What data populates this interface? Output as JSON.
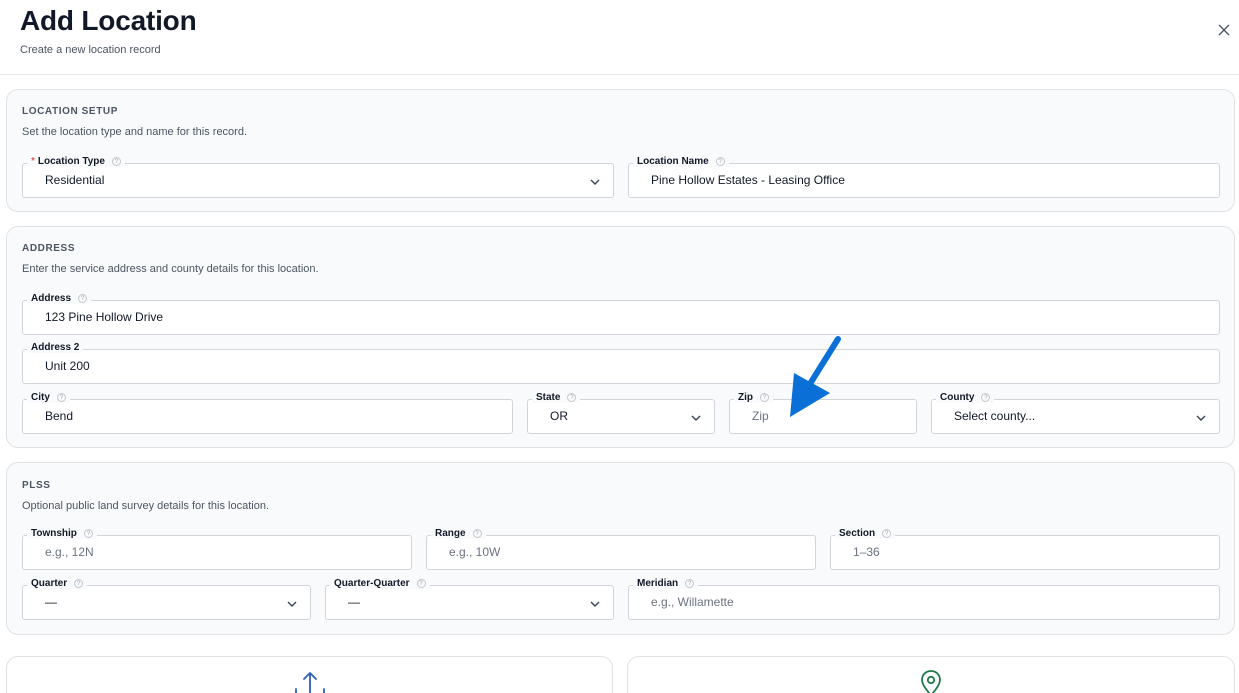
{
  "header": {
    "title": "Add Location",
    "subtitle": "Create a new location record"
  },
  "location_setup": {
    "title": "LOCATION SETUP",
    "description": "Set the location type and name for this record.",
    "location_type": {
      "label": "Location Type",
      "required": "*",
      "value": "Residential"
    },
    "location_name": {
      "label": "Location Name",
      "value": "Pine Hollow Estates - Leasing Office"
    }
  },
  "address": {
    "title": "ADDRESS",
    "description": "Enter the service address and county details for this location.",
    "address1": {
      "label": "Address",
      "value": "123 Pine Hollow Drive"
    },
    "address2": {
      "label": "Address 2",
      "value": "Unit 200"
    },
    "city": {
      "label": "City",
      "value": "Bend"
    },
    "state": {
      "label": "State",
      "value": "OR"
    },
    "zip": {
      "label": "Zip",
      "placeholder": "Zip"
    },
    "county": {
      "label": "County",
      "placeholder": "Select county..."
    }
  },
  "plss": {
    "title": "PLSS",
    "description": "Optional public land survey details for this location.",
    "township": {
      "label": "Township",
      "placeholder": "e.g., 12N"
    },
    "range": {
      "label": "Range",
      "placeholder": "e.g., 10W"
    },
    "section": {
      "label": "Section",
      "placeholder": "1–36"
    },
    "quarter": {
      "label": "Quarter",
      "value": "—"
    },
    "quarter_quarter": {
      "label": "Quarter-Quarter",
      "value": "—"
    },
    "meridian": {
      "label": "Meridian",
      "placeholder": "e.g., Willamette"
    }
  },
  "help_glyph": "?",
  "icons": {
    "close": "close-icon",
    "help": "help-icon",
    "chevron": "chevron-down-icon",
    "upload": "upload-icon",
    "map_pin": "map-pin-icon",
    "annotation_arrow": "arrow-icon"
  },
  "colors": {
    "annotation_arrow": "#0a6fd6",
    "upload_icon": "#2f5fb0",
    "map_pin_icon": "#1f7a4a",
    "required": "#dc2626"
  }
}
